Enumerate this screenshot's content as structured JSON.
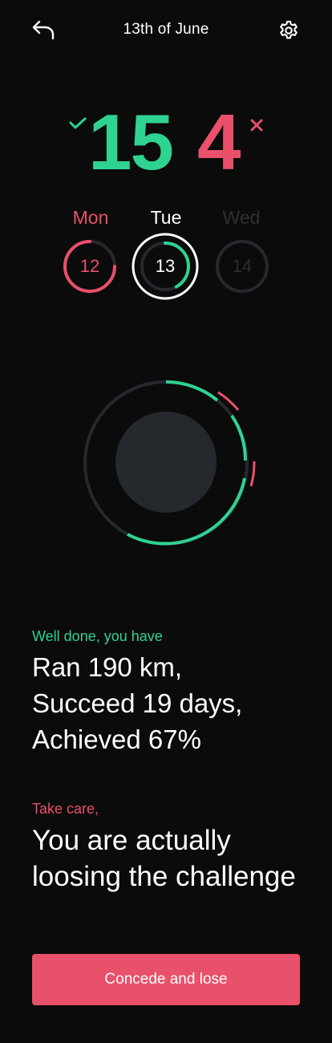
{
  "header": {
    "title": "13th of June",
    "back_icon": "back-arrow-icon",
    "settings_icon": "gear-icon"
  },
  "score": {
    "wins": "15",
    "losses": "4"
  },
  "days": [
    {
      "label": "Mon",
      "number": "12",
      "state": "lost",
      "progress": 0.75
    },
    {
      "label": "Tue",
      "number": "13",
      "state": "current",
      "progress": 0.42
    },
    {
      "label": "Wed",
      "number": "14",
      "state": "upcoming",
      "progress": 0
    }
  ],
  "summary": {
    "caption": "Well done, you have",
    "lines": [
      "Ran 190 km,",
      "Succeed 19 days,",
      "Achieved 67%"
    ]
  },
  "warning": {
    "caption": "Take care,",
    "lines": [
      "You are actually",
      "loosing the challenge"
    ]
  },
  "concede_button": {
    "label": "Concede and lose"
  },
  "colors": {
    "background": "#0b0b0b",
    "success": "#2fd391",
    "danger": "#e9506a",
    "muted": "#25292e",
    "text": "#ffffff"
  }
}
